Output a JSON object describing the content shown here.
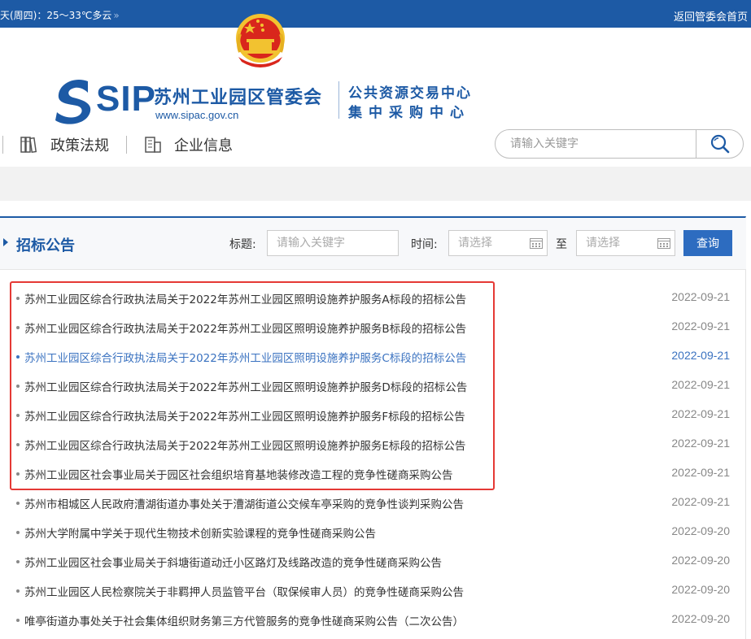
{
  "topbar": {
    "weather": "天(周四)：25～33℃多云",
    "weather_arrow": "»",
    "back_link": "返回管委会首页"
  },
  "logo": {
    "sip": "SIP",
    "name": "苏州工业园区管委会",
    "url": "www.sipac.gov.cn",
    "sub1": "公共资源交易中心",
    "sub2": "集中采购中心"
  },
  "nav": {
    "items": [
      {
        "label": "政策法规",
        "icon": "books-icon"
      },
      {
        "label": "企业信息",
        "icon": "building-icon"
      }
    ]
  },
  "search": {
    "placeholder": "请输入关键字",
    "icon": "search-icon"
  },
  "panel": {
    "title": "招标公告",
    "filter_title_label": "标题:",
    "filter_title_placeholder": "请输入关键字",
    "filter_time_label": "时间:",
    "filter_from_placeholder": "请选择",
    "filter_to": "至",
    "filter_to_placeholder": "请选择",
    "query_button": "查询"
  },
  "announcements": [
    {
      "title": "苏州工业园区综合行政执法局关于2022年苏州工业园区照明设施养护服务A标段的招标公告",
      "date": "2022-09-21"
    },
    {
      "title": "苏州工业园区综合行政执法局关于2022年苏州工业园区照明设施养护服务B标段的招标公告",
      "date": "2022-09-21"
    },
    {
      "title": "苏州工业园区综合行政执法局关于2022年苏州工业园区照明设施养护服务C标段的招标公告",
      "date": "2022-09-21",
      "active": true
    },
    {
      "title": "苏州工业园区综合行政执法局关于2022年苏州工业园区照明设施养护服务D标段的招标公告",
      "date": "2022-09-21"
    },
    {
      "title": "苏州工业园区综合行政执法局关于2022年苏州工业园区照明设施养护服务F标段的招标公告",
      "date": "2022-09-21"
    },
    {
      "title": "苏州工业园区综合行政执法局关于2022年苏州工业园区照明设施养护服务E标段的招标公告",
      "date": "2022-09-21"
    },
    {
      "title": "苏州工业园区社会事业局关于园区社会组织培育基地装修改造工程的竞争性磋商采购公告",
      "date": "2022-09-21"
    },
    {
      "title": "苏州市相城区人民政府漕湖街道办事处关于漕湖街道公交候车亭采购的竞争性谈判采购公告",
      "date": "2022-09-21"
    },
    {
      "title": "苏州大学附属中学关于现代生物技术创新实验课程的竞争性磋商采购公告",
      "date": "2022-09-20"
    },
    {
      "title": "苏州工业园区社会事业局关于斜塘街道动迁小区路灯及线路改造的竞争性磋商采购公告",
      "date": "2022-09-20"
    },
    {
      "title": "苏州工业园区人民检察院关于非羁押人员监管平台（取保候审人员）的竞争性磋商采购公告",
      "date": "2022-09-20"
    },
    {
      "title": "唯亭街道办事处关于社会集体组织财务第三方代管服务的竞争性磋商采购公告（二次公告）",
      "date": "2022-09-20"
    }
  ],
  "colors": {
    "brand": "#1d5aa5",
    "active_link": "#3a72c0",
    "highlight_box": "#e53935"
  }
}
